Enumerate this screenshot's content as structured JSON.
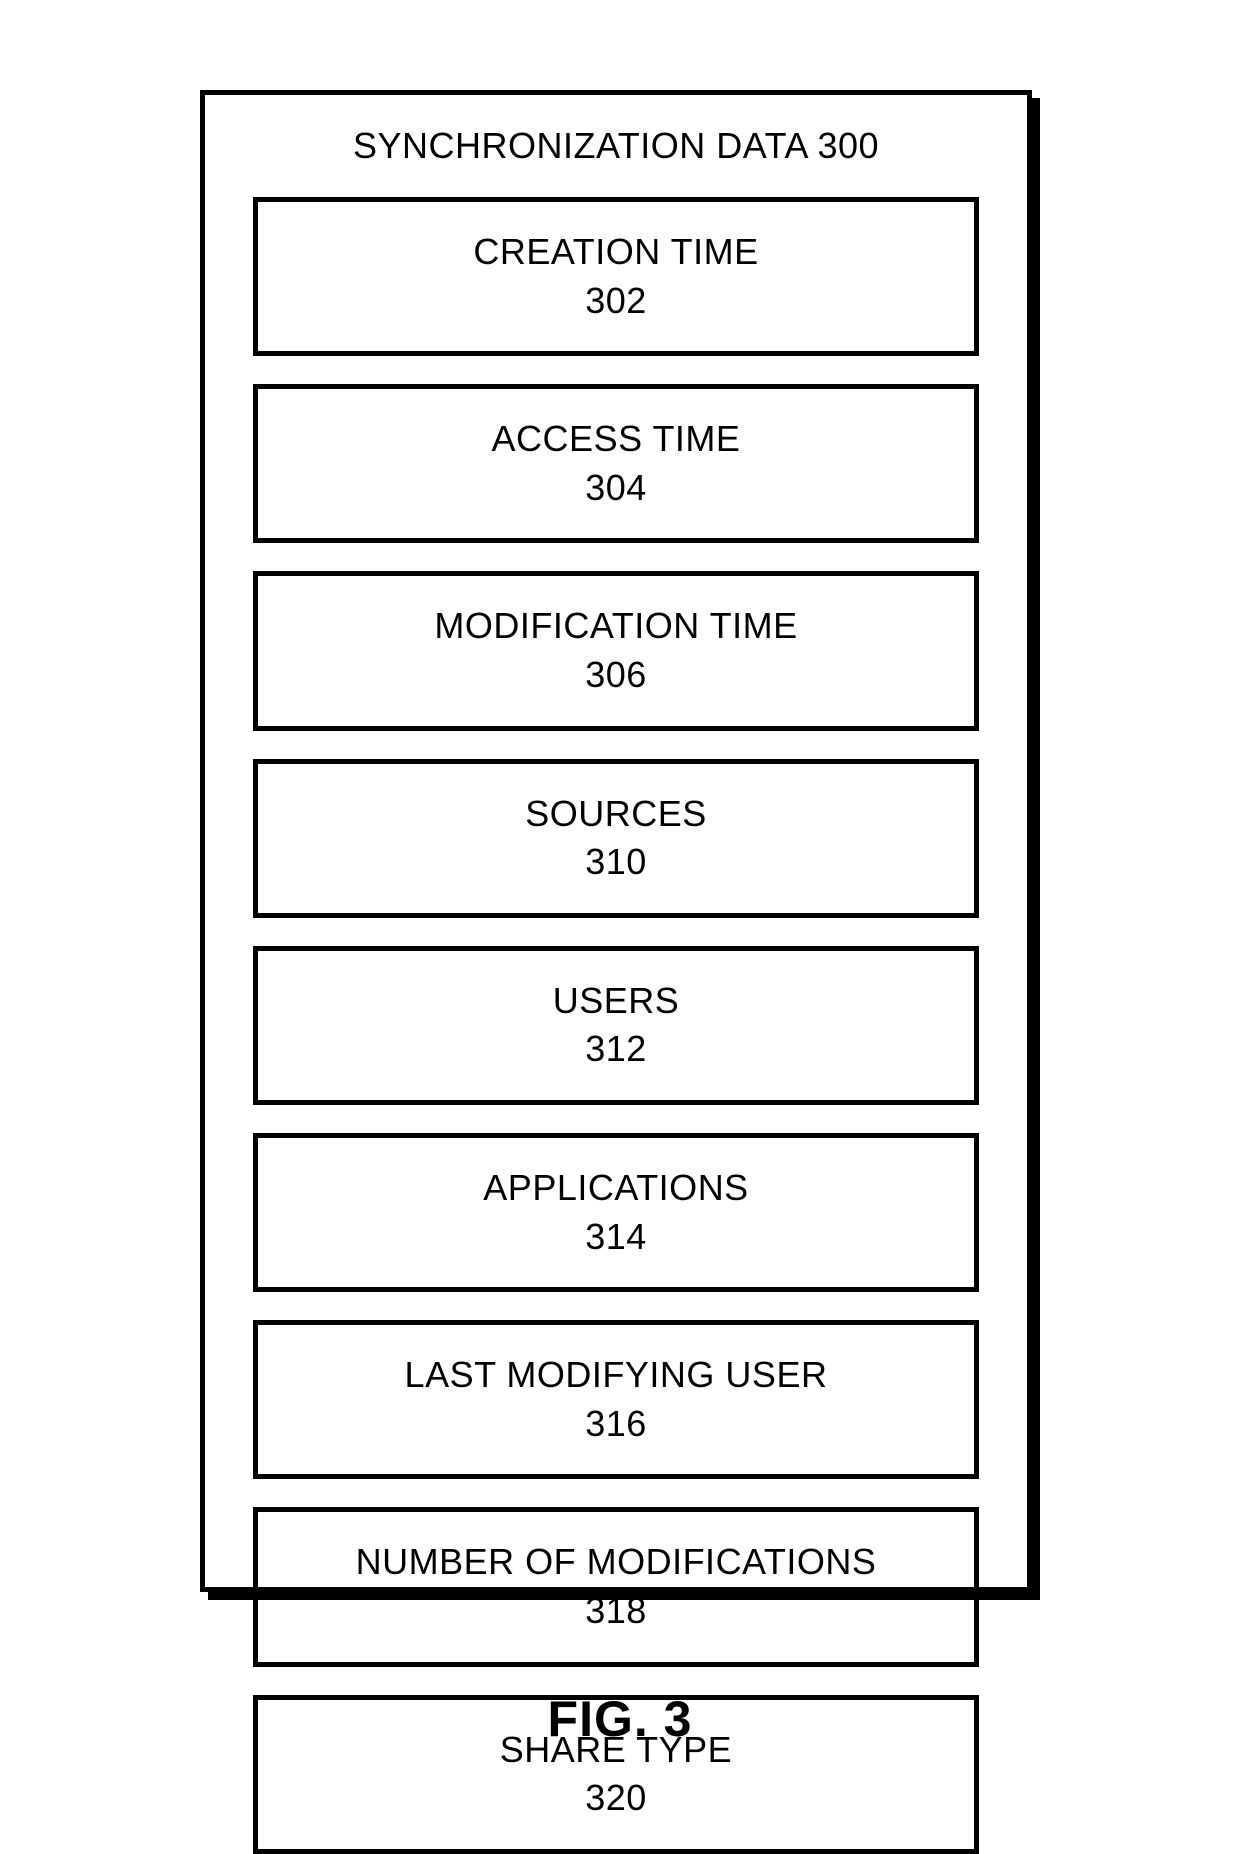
{
  "diagram": {
    "title": "SYNCHRONIZATION DATA 300",
    "items": [
      {
        "label": "CREATION TIME",
        "ref": "302"
      },
      {
        "label": "ACCESS TIME",
        "ref": "304"
      },
      {
        "label": "MODIFICATION TIME",
        "ref": "306"
      },
      {
        "label": "SOURCES",
        "ref": "310"
      },
      {
        "label": "USERS",
        "ref": "312"
      },
      {
        "label": "APPLICATIONS",
        "ref": "314"
      },
      {
        "label": "LAST MODIFYING USER",
        "ref": "316"
      },
      {
        "label": "NUMBER OF MODIFICATIONS",
        "ref": "318"
      },
      {
        "label": "SHARE TYPE",
        "ref": "320"
      }
    ],
    "caption": "FIG. 3"
  }
}
